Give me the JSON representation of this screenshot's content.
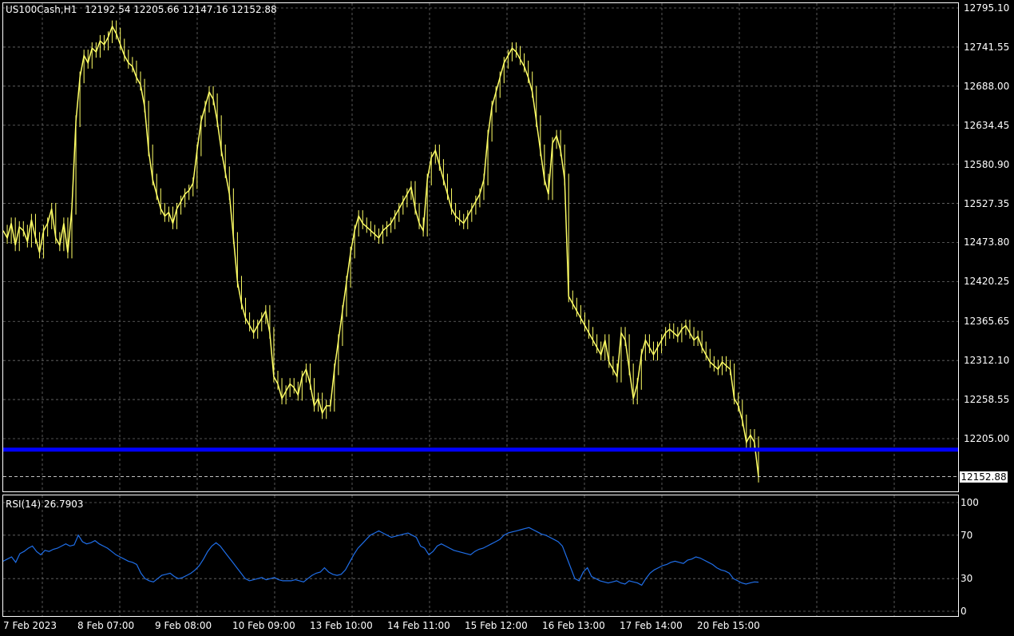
{
  "header": {
    "symbol": "US100Cash,H1",
    "ohlc": "12192.54 12205.66 12147.16 12152.88"
  },
  "rsi": {
    "label": "RSI(14) 26.7903"
  },
  "colors": {
    "background": "#000000",
    "candle": "#ffff66",
    "grid": "#6e6e6e",
    "level_line": "#0000ff",
    "rsi_line": "#1f6ee8"
  },
  "current_price_tag": "12152.88",
  "chart_data": [
    {
      "type": "line",
      "title": "US100Cash,H1",
      "grid": true,
      "style": "candlestick (approximated by hourly close path)",
      "y_ticks": [
        "12795.10",
        "12741.55",
        "12688.00",
        "12634.45",
        "12580.90",
        "12527.35",
        "12473.80",
        "12420.25",
        "12365.65",
        "12312.10",
        "12258.55",
        "12205.00"
      ],
      "ylim": [
        12150,
        12800
      ],
      "x_ticks": [
        "7 Feb 2023",
        "8 Feb 07:00",
        "9 Feb 08:00",
        "10 Feb 09:00",
        "13 Feb 10:00",
        "14 Feb 11:00",
        "15 Feb 12:00",
        "16 Feb 13:00",
        "17 Feb 14:00",
        "20 Feb 15:00"
      ],
      "horizontal_line": 12190,
      "last_price": 12152.88,
      "series": [
        {
          "values": [
            12490,
            12480,
            12500,
            12470,
            12495,
            12490,
            12475,
            12505,
            12480,
            12460,
            12490,
            12500,
            12520,
            12480,
            12470,
            12500,
            12460,
            12520,
            12640,
            12700,
            12730,
            12720,
            12740,
            12735,
            12750,
            12745,
            12755,
            12770,
            12760,
            12745,
            12730,
            12720,
            12715,
            12700,
            12690,
            12660,
            12600,
            12560,
            12540,
            12520,
            12510,
            12515,
            12500,
            12520,
            12530,
            12540,
            12545,
            12555,
            12600,
            12640,
            12660,
            12680,
            12670,
            12640,
            12600,
            12570,
            12540,
            12480,
            12420,
            12390,
            12370,
            12360,
            12350,
            12360,
            12370,
            12380,
            12350,
            12290,
            12280,
            12260,
            12270,
            12280,
            12275,
            12265,
            12290,
            12300,
            12280,
            12250,
            12260,
            12240,
            12250,
            12250,
            12300,
            12340,
            12380,
            12420,
            12460,
            12490,
            12510,
            12500,
            12495,
            12490,
            12485,
            12480,
            12490,
            12495,
            12500,
            12510,
            12520,
            12530,
            12540,
            12550,
            12520,
            12500,
            12490,
            12560,
            12590,
            12600,
            12580,
            12560,
            12540,
            12520,
            12510,
            12505,
            12500,
            12510,
            12520,
            12530,
            12540,
            12560,
            12620,
            12660,
            12680,
            12700,
            12720,
            12730,
            12740,
            12735,
            12725,
            12715,
            12700,
            12680,
            12640,
            12600,
            12560,
            12540,
            12610,
            12620,
            12600,
            12560,
            12400,
            12390,
            12380,
            12370,
            12360,
            12350,
            12340,
            12330,
            12320,
            12340,
            12310,
            12300,
            12290,
            12350,
            12340,
            12300,
            12260,
            12280,
            12320,
            12340,
            12330,
            12320,
            12330,
            12340,
            12350,
            12355,
            12350,
            12345,
            12355,
            12360,
            12350,
            12340,
            12345,
            12330,
            12320,
            12310,
            12305,
            12300,
            12310,
            12305,
            12300,
            12260,
            12250,
            12230,
            12200,
            12210,
            12200,
            12152.88
          ]
        }
      ]
    },
    {
      "type": "line",
      "title": "RSI(14) 26.7903",
      "y_ticks": [
        "100",
        "70",
        "30",
        "0"
      ],
      "ylim": [
        0,
        100
      ],
      "series": [
        {
          "values": [
            46,
            48,
            50,
            45,
            53,
            55,
            58,
            60,
            55,
            52,
            56,
            55,
            57,
            58,
            60,
            62,
            60,
            61,
            70,
            64,
            62,
            63,
            65,
            62,
            60,
            58,
            55,
            52,
            50,
            48,
            46,
            45,
            43,
            35,
            30,
            28,
            27,
            30,
            33,
            34,
            35,
            32,
            30,
            31,
            33,
            35,
            38,
            42,
            48,
            55,
            60,
            63,
            60,
            55,
            50,
            45,
            40,
            35,
            30,
            28,
            29,
            30,
            31,
            29,
            30,
            31,
            29,
            28,
            28,
            28,
            29,
            28,
            27,
            30,
            33,
            35,
            36,
            40,
            36,
            34,
            33,
            34,
            38,
            45,
            52,
            58,
            62,
            66,
            70,
            72,
            74,
            72,
            70,
            68,
            69,
            70,
            71,
            72,
            70,
            68,
            60,
            58,
            52,
            55,
            60,
            62,
            60,
            58,
            56,
            55,
            54,
            53,
            52,
            55,
            57,
            58,
            60,
            62,
            64,
            66,
            70,
            72,
            73,
            74,
            75,
            76,
            77,
            75,
            73,
            71,
            70,
            68,
            66,
            64,
            60,
            50,
            40,
            30,
            28,
            36,
            40,
            32,
            30,
            28,
            27,
            26,
            27,
            28,
            26,
            25,
            28,
            27,
            26,
            24,
            30,
            35,
            38,
            40,
            42,
            43,
            45,
            46,
            45,
            44,
            47,
            48,
            50,
            49,
            47,
            45,
            43,
            40,
            38,
            37,
            35,
            30,
            28,
            26,
            25,
            26,
            27,
            26.79
          ]
        }
      ]
    }
  ]
}
